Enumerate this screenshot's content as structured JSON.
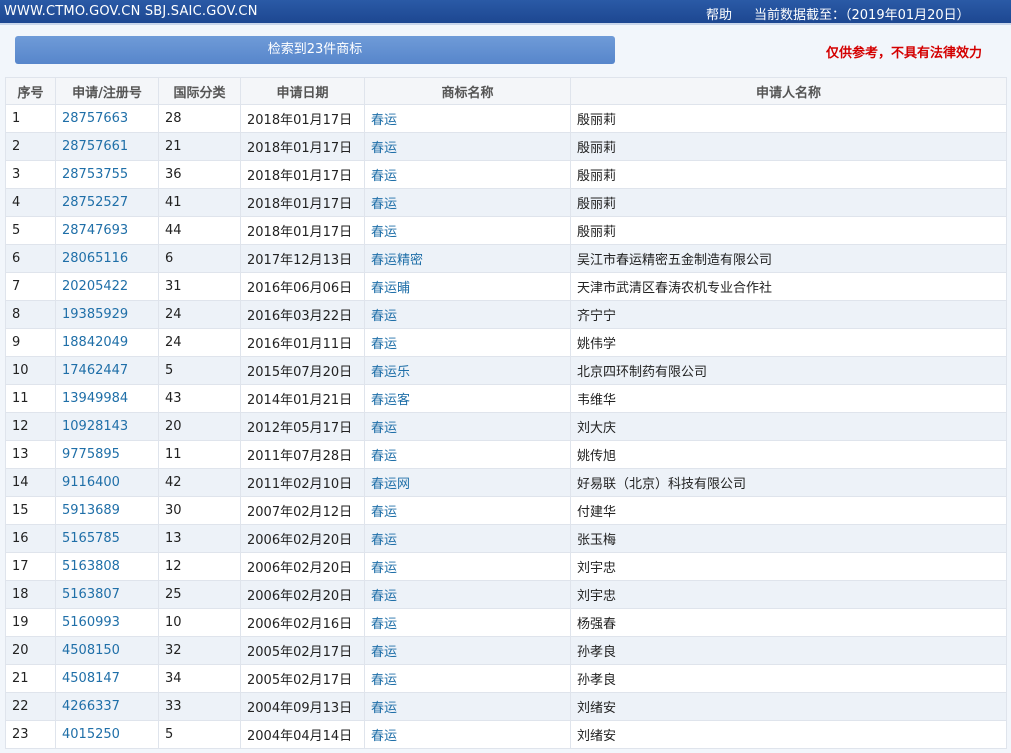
{
  "header": {
    "site_text": "WWW.CTMO.GOV.CN SBJ.SAIC.GOV.CN",
    "help_label": "帮助",
    "data_date_text": "当前数据截至：（2019年01月20日）"
  },
  "result_count_text": "检索到23件商标",
  "disclaimer": "仅供参考，不具有法律效力",
  "table": {
    "columns": [
      "序号",
      "申请/注册号",
      "国际分类",
      "申请日期",
      "商标名称",
      "申请人名称"
    ],
    "rows": [
      {
        "no": "1",
        "reg": "28757663",
        "cls": "28",
        "date": "2018年01月17日",
        "mark": "春运",
        "applicant": "殷丽莉"
      },
      {
        "no": "2",
        "reg": "28757661",
        "cls": "21",
        "date": "2018年01月17日",
        "mark": "春运",
        "applicant": "殷丽莉"
      },
      {
        "no": "3",
        "reg": "28753755",
        "cls": "36",
        "date": "2018年01月17日",
        "mark": "春运",
        "applicant": "殷丽莉"
      },
      {
        "no": "4",
        "reg": "28752527",
        "cls": "41",
        "date": "2018年01月17日",
        "mark": "春运",
        "applicant": "殷丽莉"
      },
      {
        "no": "5",
        "reg": "28747693",
        "cls": "44",
        "date": "2018年01月17日",
        "mark": "春运",
        "applicant": "殷丽莉"
      },
      {
        "no": "6",
        "reg": "28065116",
        "cls": "6",
        "date": "2017年12月13日",
        "mark": "春运精密",
        "applicant": "吴江市春运精密五金制造有限公司"
      },
      {
        "no": "7",
        "reg": "20205422",
        "cls": "31",
        "date": "2016年06月06日",
        "mark": "春运晡",
        "applicant": "天津市武清区春涛农机专业合作社"
      },
      {
        "no": "8",
        "reg": "19385929",
        "cls": "24",
        "date": "2016年03月22日",
        "mark": "春运",
        "applicant": "齐宁宁"
      },
      {
        "no": "9",
        "reg": "18842049",
        "cls": "24",
        "date": "2016年01月11日",
        "mark": "春运",
        "applicant": "姚伟学"
      },
      {
        "no": "10",
        "reg": "17462447",
        "cls": "5",
        "date": "2015年07月20日",
        "mark": "春运乐",
        "applicant": "北京四环制药有限公司"
      },
      {
        "no": "11",
        "reg": "13949984",
        "cls": "43",
        "date": "2014年01月21日",
        "mark": "春运客",
        "applicant": "韦维华"
      },
      {
        "no": "12",
        "reg": "10928143",
        "cls": "20",
        "date": "2012年05月17日",
        "mark": "春运",
        "applicant": "刘大庆"
      },
      {
        "no": "13",
        "reg": "9775895",
        "cls": "11",
        "date": "2011年07月28日",
        "mark": "春运",
        "applicant": "姚传旭"
      },
      {
        "no": "14",
        "reg": "9116400",
        "cls": "42",
        "date": "2011年02月10日",
        "mark": "春运网",
        "applicant": "好易联（北京）科技有限公司"
      },
      {
        "no": "15",
        "reg": "5913689",
        "cls": "30",
        "date": "2007年02月12日",
        "mark": "春运",
        "applicant": "付建华"
      },
      {
        "no": "16",
        "reg": "5165785",
        "cls": "13",
        "date": "2006年02月20日",
        "mark": "春运",
        "applicant": "张玉梅"
      },
      {
        "no": "17",
        "reg": "5163808",
        "cls": "12",
        "date": "2006年02月20日",
        "mark": "春运",
        "applicant": "刘宇忠"
      },
      {
        "no": "18",
        "reg": "5163807",
        "cls": "25",
        "date": "2006年02月20日",
        "mark": "春运",
        "applicant": "刘宇忠"
      },
      {
        "no": "19",
        "reg": "5160993",
        "cls": "10",
        "date": "2006年02月16日",
        "mark": "春运",
        "applicant": "杨强春"
      },
      {
        "no": "20",
        "reg": "4508150",
        "cls": "32",
        "date": "2005年02月17日",
        "mark": "春运",
        "applicant": "孙孝良"
      },
      {
        "no": "21",
        "reg": "4508147",
        "cls": "34",
        "date": "2005年02月17日",
        "mark": "春运",
        "applicant": "孙孝良"
      },
      {
        "no": "22",
        "reg": "4266337",
        "cls": "33",
        "date": "2004年09月13日",
        "mark": "春运",
        "applicant": "刘绪安"
      },
      {
        "no": "23",
        "reg": "4015250",
        "cls": "5",
        "date": "2004年04月14日",
        "mark": "春运",
        "applicant": "刘绪安"
      }
    ]
  }
}
